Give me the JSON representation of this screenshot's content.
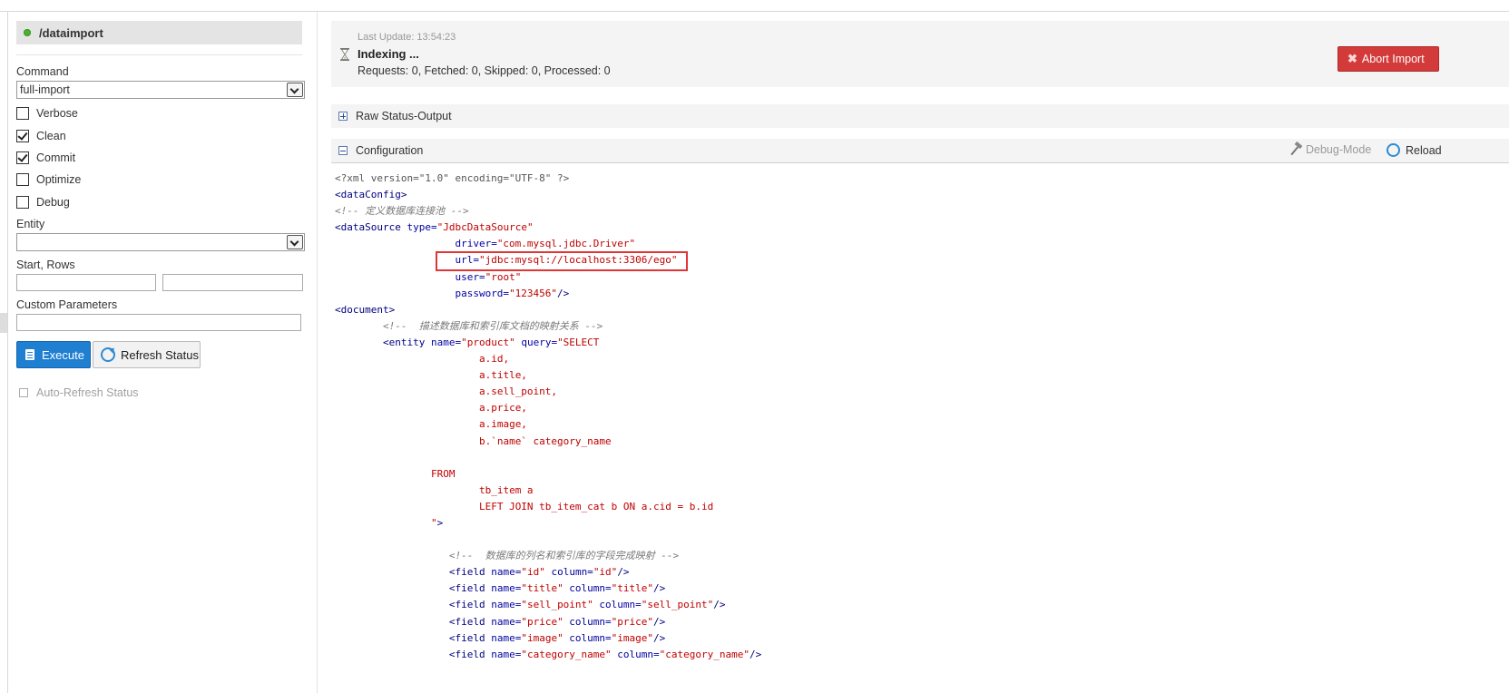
{
  "handler": {
    "name": "/dataimport"
  },
  "form": {
    "command_label": "Command",
    "command_value": "full-import",
    "checkboxes": [
      {
        "label": "Verbose",
        "checked": false
      },
      {
        "label": "Clean",
        "checked": true
      },
      {
        "label": "Commit",
        "checked": true
      },
      {
        "label": "Optimize",
        "checked": false
      },
      {
        "label": "Debug",
        "checked": false
      }
    ],
    "entity_label": "Entity",
    "entity_value": "",
    "start_rows_label": "Start, Rows",
    "custom_params_label": "Custom Parameters",
    "execute_label": "Execute",
    "refresh_label": "Refresh Status",
    "auto_refresh_label": "Auto-Refresh Status"
  },
  "status": {
    "last_update": "Last Update: 13:54:23",
    "state": "Indexing ...",
    "counts": "Requests: 0, Fetched: 0, Skipped: 0, Processed: 0",
    "abort_label": "Abort Import"
  },
  "sections": {
    "raw_status": "Raw Status-Output",
    "configuration": "Configuration",
    "debug_mode": "Debug-Mode",
    "reload": "Reload"
  },
  "config_lines": [
    [
      [
        "decl",
        "<?xml version=\"1.0\" encoding=\"UTF-8\" ?>"
      ]
    ],
    [
      [
        "tg",
        "<dataConfig>"
      ]
    ],
    [
      [
        "cm",
        "<!-- 定义数据库连接池 -->"
      ]
    ],
    [
      [
        "tg",
        "<dataSource "
      ],
      [
        "at",
        "type="
      ],
      [
        "st",
        "\"JdbcDataSource\""
      ]
    ],
    [
      [
        "",
        "                    "
      ],
      [
        "at",
        "driver="
      ],
      [
        "st",
        "\"com.mysql.jdbc.Driver\""
      ]
    ],
    [
      [
        "",
        "                    "
      ],
      [
        "at",
        "url="
      ],
      [
        "st",
        "\"jdbc:mysql://localhost:3306/ego\""
      ]
    ],
    [
      [
        "",
        "                    "
      ],
      [
        "at",
        "user="
      ],
      [
        "st",
        "\"root\""
      ]
    ],
    [
      [
        "",
        "                    "
      ],
      [
        "at",
        "password="
      ],
      [
        "st",
        "\"123456\""
      ],
      [
        "tg",
        "/>"
      ]
    ],
    [
      [
        "tg",
        "<document>"
      ]
    ],
    [
      [
        "",
        "        "
      ],
      [
        "cm",
        "<!--  描述数据库和索引库文档的映射关系 -->"
      ]
    ],
    [
      [
        "",
        "        "
      ],
      [
        "tg",
        "<entity "
      ],
      [
        "at",
        "name="
      ],
      [
        "st",
        "\"product\""
      ],
      [
        "at",
        " query="
      ],
      [
        "st",
        "\"SELECT"
      ]
    ],
    [
      [
        "",
        "                        "
      ],
      [
        "sq",
        "a.id,"
      ]
    ],
    [
      [
        "",
        "                        "
      ],
      [
        "sq",
        "a.title,"
      ]
    ],
    [
      [
        "",
        "                        "
      ],
      [
        "sq",
        "a.sell_point,"
      ]
    ],
    [
      [
        "",
        "                        "
      ],
      [
        "sq",
        "a.price,"
      ]
    ],
    [
      [
        "",
        "                        "
      ],
      [
        "sq",
        "a.image,"
      ]
    ],
    [
      [
        "",
        "                        "
      ],
      [
        "sq",
        "b.`name` category_name"
      ]
    ],
    [
      [
        "",
        ""
      ]
    ],
    [
      [
        "",
        "                "
      ],
      [
        "sq",
        "FROM"
      ]
    ],
    [
      [
        "",
        "                        "
      ],
      [
        "sq",
        "tb_item a"
      ]
    ],
    [
      [
        "",
        "                        "
      ],
      [
        "sq",
        "LEFT JOIN tb_item_cat b ON a.cid = b.id"
      ]
    ],
    [
      [
        "",
        "                "
      ],
      [
        "st",
        "\""
      ],
      [
        "tg",
        ">"
      ]
    ],
    [
      [
        "",
        ""
      ]
    ],
    [
      [
        "",
        "                   "
      ],
      [
        "cm",
        "<!--  数据库的列名和索引库的字段完成映射 -->"
      ]
    ],
    [
      [
        "",
        "                   "
      ],
      [
        "tg",
        "<field "
      ],
      [
        "at",
        "name="
      ],
      [
        "st",
        "\"id\""
      ],
      [
        "at",
        " column="
      ],
      [
        "st",
        "\"id\""
      ],
      [
        "tg",
        "/>"
      ]
    ],
    [
      [
        "",
        "                   "
      ],
      [
        "tg",
        "<field "
      ],
      [
        "at",
        "name="
      ],
      [
        "st",
        "\"title\""
      ],
      [
        "at",
        " column="
      ],
      [
        "st",
        "\"title\""
      ],
      [
        "tg",
        "/>"
      ]
    ],
    [
      [
        "",
        "                   "
      ],
      [
        "tg",
        "<field "
      ],
      [
        "at",
        "name="
      ],
      [
        "st",
        "\"sell_point\""
      ],
      [
        "at",
        " column="
      ],
      [
        "st",
        "\"sell_point\""
      ],
      [
        "tg",
        "/>"
      ]
    ],
    [
      [
        "",
        "                   "
      ],
      [
        "tg",
        "<field "
      ],
      [
        "at",
        "name="
      ],
      [
        "st",
        "\"price\""
      ],
      [
        "at",
        " column="
      ],
      [
        "st",
        "\"price\""
      ],
      [
        "tg",
        "/>"
      ]
    ],
    [
      [
        "",
        "                   "
      ],
      [
        "tg",
        "<field "
      ],
      [
        "at",
        "name="
      ],
      [
        "st",
        "\"image\""
      ],
      [
        "at",
        " column="
      ],
      [
        "st",
        "\"image\""
      ],
      [
        "tg",
        "/>"
      ]
    ],
    [
      [
        "",
        "                   "
      ],
      [
        "tg",
        "<field "
      ],
      [
        "at",
        "name="
      ],
      [
        "st",
        "\"category_name\""
      ],
      [
        "at",
        " column="
      ],
      [
        "st",
        "\"category_name\""
      ],
      [
        "tg",
        "/>"
      ]
    ]
  ],
  "colors": {
    "accent": "#1f7fd0",
    "abort": "#d33a3a",
    "highlight": "#e23535",
    "status_ok": "#4caf30"
  }
}
